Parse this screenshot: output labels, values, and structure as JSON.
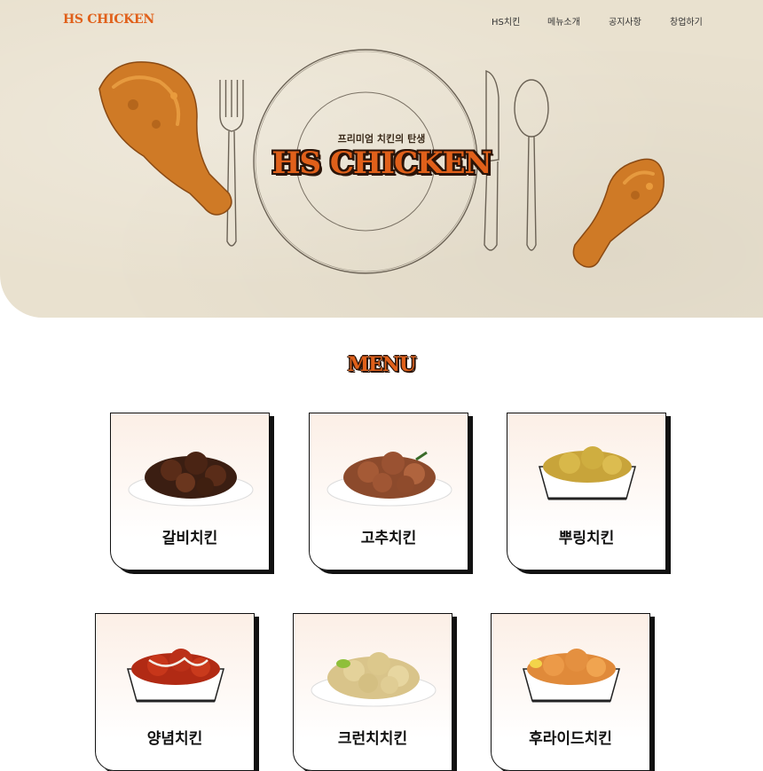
{
  "header": {
    "logo": "HS CHICKEN",
    "nav": [
      "HS치킨",
      "메뉴소개",
      "공지사항",
      "창업하기"
    ]
  },
  "hero": {
    "tagline": "프리미엄 치킨의 탄생",
    "title": "HS CHICKEN"
  },
  "menu": {
    "title": "MENU",
    "items": [
      {
        "label": "갈비치킨",
        "icon": "galbi-chicken-plate"
      },
      {
        "label": "고추치킨",
        "icon": "pepper-chicken-plate"
      },
      {
        "label": "뿌링치킨",
        "icon": "bburing-chicken-basket"
      },
      {
        "label": "양념치킨",
        "icon": "yangnyeom-chicken-basket"
      },
      {
        "label": "크런치치킨",
        "icon": "crunch-chicken-plate"
      },
      {
        "label": "후라이드치킨",
        "icon": "fried-chicken-basket"
      }
    ]
  },
  "colors": {
    "brand": "#e0601a",
    "outline": "#2b1408",
    "hero_bg": "#e9e1cf",
    "card_bg": "#fcefe6"
  }
}
